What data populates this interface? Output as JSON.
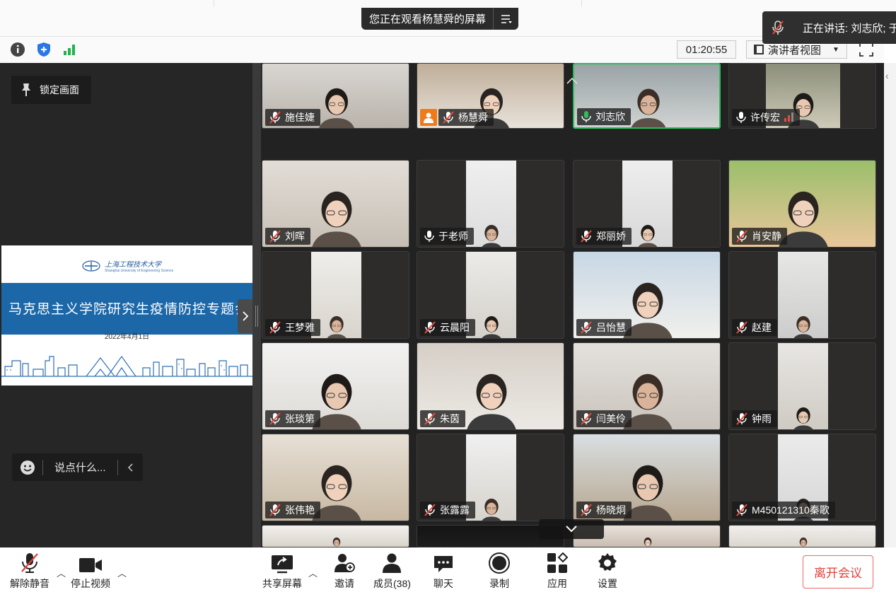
{
  "top": {
    "share_banner": "您正在观看杨慧舜的屏幕",
    "speaking": "正在讲话: 刘志欣; 于"
  },
  "info_bar": {
    "timer": "01:20:55",
    "view_mode": "演讲者视图"
  },
  "left_panel": {
    "lock_label": "锁定画面",
    "chat_placeholder": "说点什么...",
    "slide": {
      "university": "上海工程技术大学",
      "university_en": "Shanghai University of Engineering Science",
      "title": "马克思主义学院研究生疫情防控专题会",
      "date": "2022年4月1日"
    }
  },
  "participants": [
    {
      "name": "施佳婕",
      "mic": "muted"
    },
    {
      "name": "杨慧舜",
      "mic": "muted",
      "host": true
    },
    {
      "name": "刘志欣",
      "mic": "on",
      "active": true
    },
    {
      "name": "许传宏",
      "mic": "on-dark"
    },
    {
      "name": "刘晖",
      "mic": "muted"
    },
    {
      "name": "于老师",
      "mic": "on-dark"
    },
    {
      "name": "郑丽娇",
      "mic": "muted"
    },
    {
      "name": "肖安静",
      "mic": "muted"
    },
    {
      "name": "王梦雅",
      "mic": "muted"
    },
    {
      "name": "云晨阳",
      "mic": "muted"
    },
    {
      "name": "吕怡慧",
      "mic": "muted"
    },
    {
      "name": "赵建",
      "mic": "muted"
    },
    {
      "name": "张琰第",
      "mic": "muted"
    },
    {
      "name": "朱茵",
      "mic": "muted"
    },
    {
      "name": "闫美伶",
      "mic": "muted"
    },
    {
      "name": "钟雨",
      "mic": "muted"
    },
    {
      "name": "张伟艳",
      "mic": "muted"
    },
    {
      "name": "张露露",
      "mic": "muted"
    },
    {
      "name": "杨晓炯",
      "mic": "muted"
    },
    {
      "name": "M450121310秦歌",
      "mic": "muted"
    },
    {
      "name": "",
      "mic": "none"
    },
    {
      "name": "",
      "mic": "none"
    },
    {
      "name": "",
      "mic": "none"
    },
    {
      "name": "",
      "mic": "none"
    }
  ],
  "toolbar": {
    "unmute": "解除静音",
    "stop_video": "停止视频",
    "share_screen": "共享屏幕",
    "invite": "邀请",
    "members": "成员(38)",
    "chat": "聊天",
    "record": "录制",
    "apps": "应用",
    "settings": "设置",
    "leave": "离开会议"
  },
  "colors": {
    "accent_green": "#2dbd5a",
    "leave_red": "#e0433a",
    "slide_blue": "#1b67a8",
    "host_orange": "#f07a19"
  }
}
